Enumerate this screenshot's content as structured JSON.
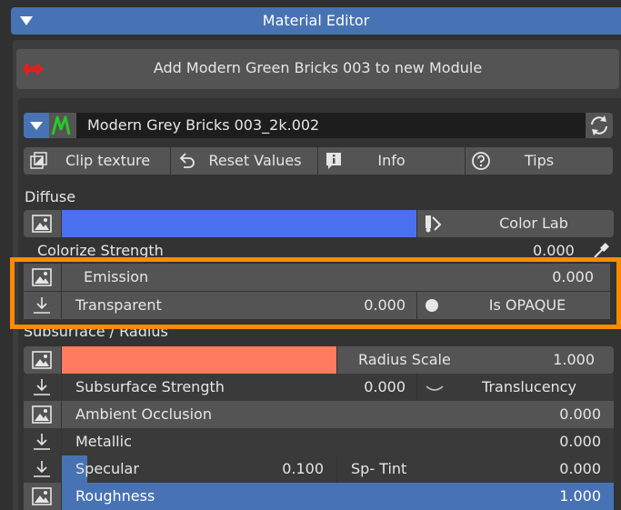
{
  "panel": {
    "title": "Material Editor"
  },
  "add_button": {
    "label": "Add Modern Green Bricks 003 to new Module"
  },
  "material": {
    "name": "Modern Grey Bricks 003_2k.002"
  },
  "toolbar": {
    "clip_label": "Clip texture",
    "reset_label": "Reset Values",
    "info_label": "Info",
    "tips_label": "Tips"
  },
  "diffuse": {
    "label": "Diffuse",
    "color": "#4a70f0",
    "color_lab_label": "Color Lab",
    "colorize_label": "Colorize Strength",
    "colorize_value": "0.000"
  },
  "emission": {
    "label": "Emission",
    "value": "0.000"
  },
  "transparent": {
    "label": "Transparent",
    "value": "0.000",
    "opaque_label": "Is OPAQUE"
  },
  "subsurface": {
    "label": "Subsurface / Radius",
    "color": "#ff7a5e",
    "radius_label": "Radius Scale",
    "radius_value": "1.000",
    "strength_label": "Subsurface Strength",
    "strength_value": "0.000",
    "translucency_label": "Translucency"
  },
  "ao": {
    "label": "Ambient Occlusion",
    "value": "0.000"
  },
  "metallic": {
    "label": "Metallic",
    "value": "0.000"
  },
  "specular": {
    "label": "Specular",
    "value": "0.100",
    "tint_label": "Sp- Tint",
    "tint_value": "0.000"
  },
  "roughness": {
    "label": "Roughness",
    "value": "1.000"
  },
  "colors": {
    "accent": "#4772b3",
    "highlight": "#ff8a00"
  }
}
